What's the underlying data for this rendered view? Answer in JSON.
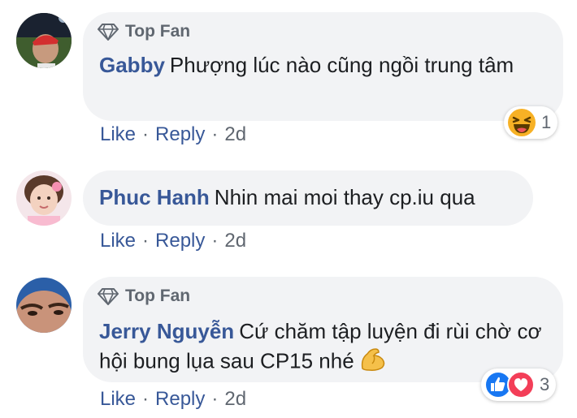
{
  "comments": [
    {
      "badge": "Top Fan",
      "author": "Gabby",
      "text": "Phượng lúc nào cũng ngồi trung tâm",
      "actions": {
        "like": "Like",
        "reply": "Reply",
        "sep": "·",
        "time": "2d"
      },
      "reactions": {
        "icons": [
          "laughing-emoji-icon"
        ],
        "count": "1"
      }
    },
    {
      "badge": "",
      "author": "Phuc Hanh",
      "text": "Nhin mai moi thay cp.iu qua",
      "actions": {
        "like": "Like",
        "reply": "Reply",
        "sep": "·",
        "time": "2d"
      }
    },
    {
      "badge": "Top Fan",
      "author": "Jerry Nguyễn",
      "text": "Cứ chăm tập luyện đi rùi chờ cơ hội bung lụa sau CP15 nhé",
      "text_emoji": "flexed-biceps-icon",
      "actions": {
        "like": "Like",
        "reply": "Reply",
        "sep": "·",
        "time": "2d"
      },
      "reactions": {
        "icons": [
          "like-reaction-icon",
          "love-reaction-icon"
        ],
        "count": "3"
      }
    }
  ],
  "colors": {
    "link": "#385898",
    "muted": "#606770",
    "bubble": "#f2f3f5",
    "like_blue": "#1877f2",
    "love_red": "#f33e58"
  }
}
